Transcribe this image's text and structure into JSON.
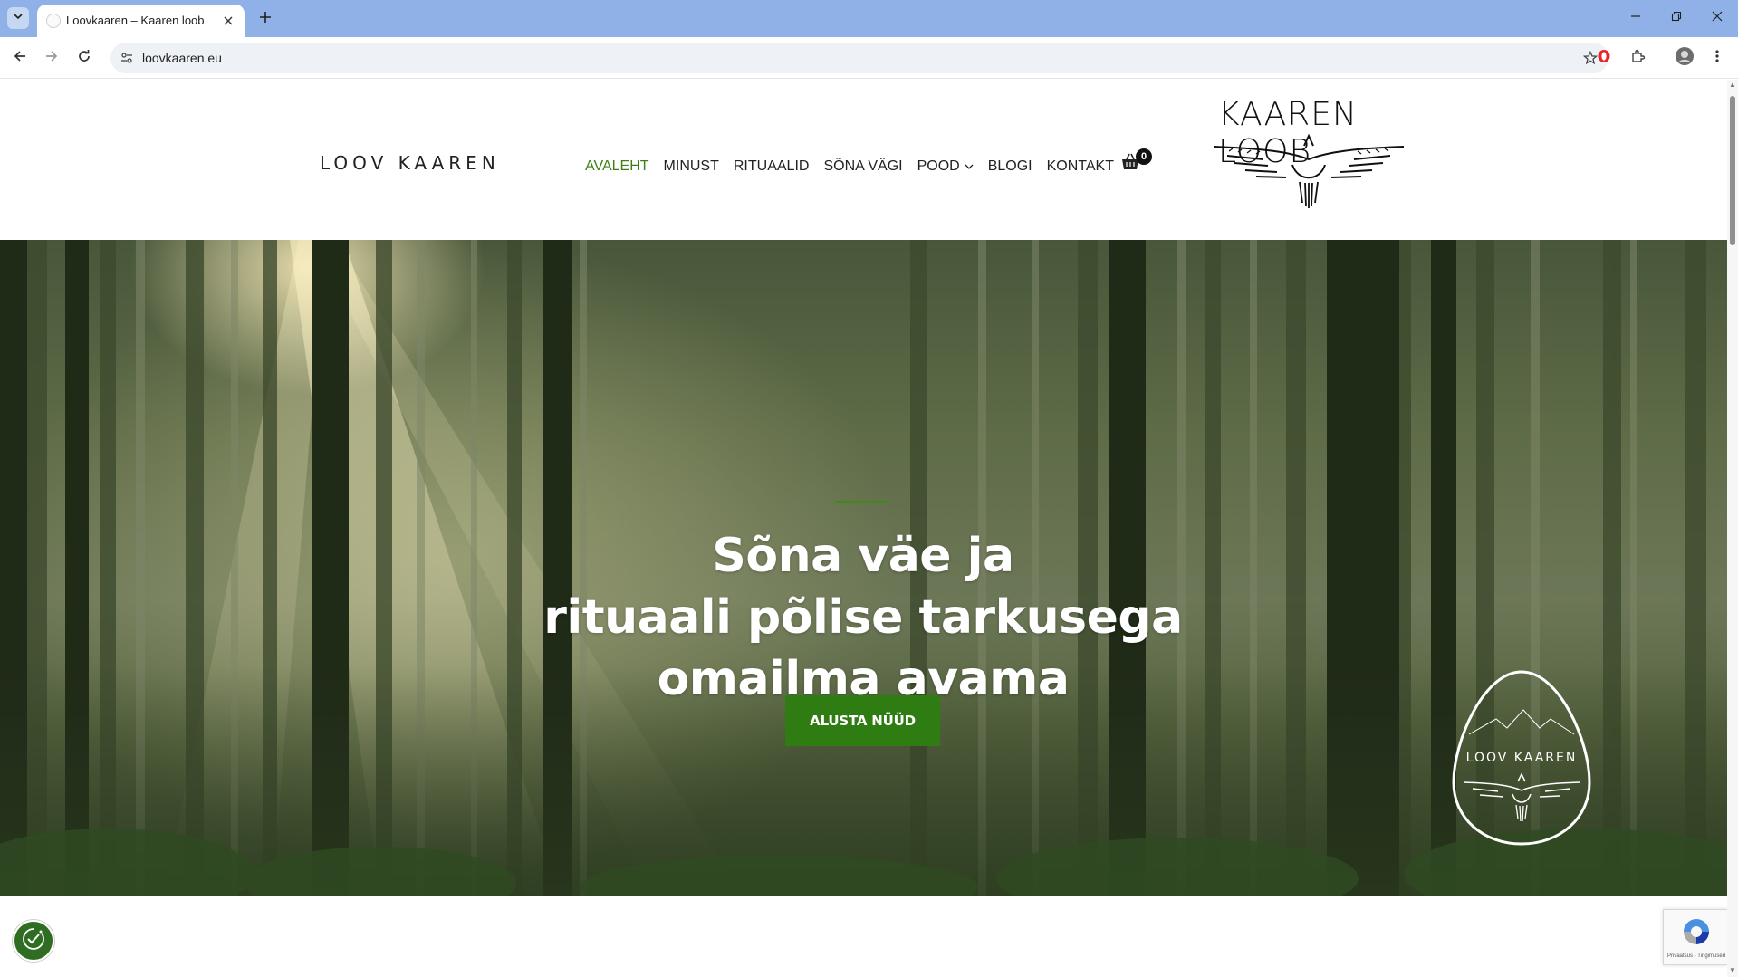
{
  "browser": {
    "tab_title": "Loovkaaren – Kaaren loob",
    "url": "loovkaaren.eu"
  },
  "header": {
    "logo_text": "LOOV KAAREN",
    "brand_title": "KAAREN LOOB",
    "nav": [
      {
        "label": "AVALEHT"
      },
      {
        "label": "MINUST"
      },
      {
        "label": "RITUAALID"
      },
      {
        "label": "SÕNA VÄGI"
      },
      {
        "label": "POOD"
      },
      {
        "label": "BLOGI"
      },
      {
        "label": "KONTAKT"
      }
    ],
    "cart_count": "0"
  },
  "hero": {
    "title_line1": "Sõna väe ja",
    "title_line2": "rituaali põlise tarkusega",
    "title_line3": "omailma avama",
    "cta_label": "ALUSTA NÜÜD",
    "badge_text": "LOOV KAAREN"
  },
  "recaptcha": {
    "footer_text": "Privaatsus - Tingimused"
  },
  "colors": {
    "accent_green": "#3f7f16",
    "cta_green": "#2f7d12",
    "tabbar_blue": "#8fb1e8"
  },
  "icons": [
    "tab-list-icon",
    "favicon-icon",
    "close-icon",
    "plus-icon",
    "minimize-icon",
    "restore-icon",
    "back-icon",
    "forward-icon",
    "reload-icon",
    "site-info-icon",
    "star-icon",
    "opera-icon",
    "extensions-icon",
    "profile-avatar",
    "menu-icon",
    "cart-icon",
    "chevron-down-icon",
    "cookie-settings-icon",
    "recaptcha-icon"
  ]
}
